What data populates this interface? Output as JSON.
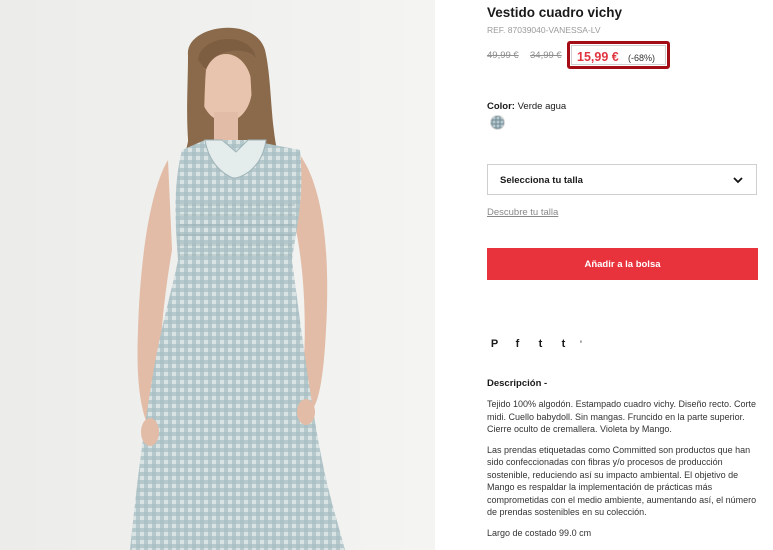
{
  "product": {
    "title": "Vestido cuadro vichy",
    "ref": "REF. 87039040-VANESSA-LV",
    "prices": {
      "old1": "49,99 €",
      "old2": "34,99 €",
      "current": "15,99 €",
      "discount": "(-68%)"
    },
    "color": {
      "label": "Color:",
      "value": "Verde agua",
      "swatch_color": "#b9c8cd"
    },
    "size_select": {
      "label": "Selecciona tu talla",
      "icon": "chevron-down-icon"
    },
    "size_link": "Descubre tu talla",
    "add_button": "Añadir a la bolsa",
    "social": {
      "icons": [
        "pinterest-icon",
        "facebook-icon",
        "twitter-icon",
        "tumblr-icon"
      ],
      "glyphs": [
        "P",
        "f",
        "t",
        "t"
      ],
      "separator": "'"
    },
    "description": {
      "title": "Descripción -",
      "paragraphs": [
        "Tejido 100% algodón. Estampado cuadro vichy. Diseño recto. Corte midi. Cuello babydoll. Sin mangas. Fruncido en la parte superior. Cierre oculto de cremallera. Violeta by Mango.",
        "Las prendas etiquetadas como Committed son productos que han sido confeccionadas con fibras y/o procesos de producción sostenible, reduciendo así su impacto ambiental. El objetivo de Mango es respaldar la implementación de prácticas más comprometidas con el medio ambiente, aumentando así, el número de prendas sostenibles en su colección.",
        "Largo de costado 99.0 cm"
      ]
    }
  },
  "colors": {
    "accent_red": "#e8323c",
    "price_red": "#e0353f",
    "highlight_border": "#a50d16"
  }
}
